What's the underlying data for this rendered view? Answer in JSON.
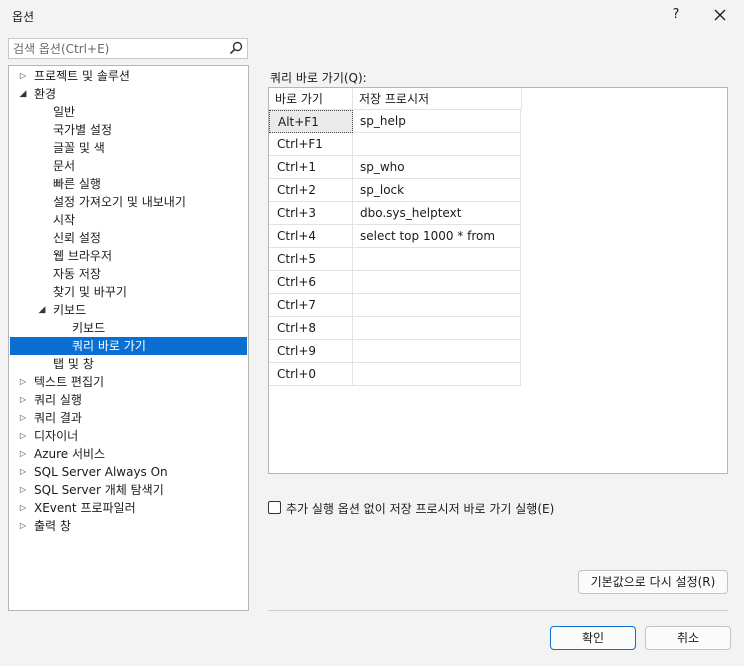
{
  "window": {
    "title": "옵션",
    "help_label": "?",
    "close_label": "✕"
  },
  "search": {
    "placeholder": "검색 옵션(Ctrl+E)",
    "icon": "search-icon"
  },
  "tree": [
    {
      "label": "프로젝트 및 솔루션",
      "level": 0,
      "arrow": "collapsed"
    },
    {
      "label": "환경",
      "level": 0,
      "arrow": "expanded"
    },
    {
      "label": "일반",
      "level": 1,
      "arrow": "none"
    },
    {
      "label": "국가별 설정",
      "level": 1,
      "arrow": "none"
    },
    {
      "label": "글꼴 및 색",
      "level": 1,
      "arrow": "none"
    },
    {
      "label": "문서",
      "level": 1,
      "arrow": "none"
    },
    {
      "label": "빠른 실행",
      "level": 1,
      "arrow": "none"
    },
    {
      "label": "설정 가져오기 및 내보내기",
      "level": 1,
      "arrow": "none"
    },
    {
      "label": "시작",
      "level": 1,
      "arrow": "none"
    },
    {
      "label": "신뢰 설정",
      "level": 1,
      "arrow": "none"
    },
    {
      "label": "웹 브라우저",
      "level": 1,
      "arrow": "none"
    },
    {
      "label": "자동 저장",
      "level": 1,
      "arrow": "none"
    },
    {
      "label": "찾기 및 바꾸기",
      "level": 1,
      "arrow": "none"
    },
    {
      "label": "키보드",
      "level": 1,
      "arrow": "expanded"
    },
    {
      "label": "키보드",
      "level": 2,
      "arrow": "none"
    },
    {
      "label": "쿼리 바로 가기",
      "level": 2,
      "arrow": "none",
      "selected": true
    },
    {
      "label": "탭 및 창",
      "level": 1,
      "arrow": "none"
    },
    {
      "label": "텍스트 편집기",
      "level": 0,
      "arrow": "collapsed"
    },
    {
      "label": "쿼리 실행",
      "level": 0,
      "arrow": "collapsed"
    },
    {
      "label": "쿼리 결과",
      "level": 0,
      "arrow": "collapsed"
    },
    {
      "label": "디자이너",
      "level": 0,
      "arrow": "collapsed"
    },
    {
      "label": "Azure 서비스",
      "level": 0,
      "arrow": "collapsed"
    },
    {
      "label": "SQL Server Always On",
      "level": 0,
      "arrow": "collapsed"
    },
    {
      "label": "SQL Server 개체 탐색기",
      "level": 0,
      "arrow": "collapsed"
    },
    {
      "label": "XEvent 프로파일러",
      "level": 0,
      "arrow": "collapsed"
    },
    {
      "label": "출력 창",
      "level": 0,
      "arrow": "collapsed"
    }
  ],
  "shortcuts": {
    "label": "쿼리 바로 가기(Q):",
    "columns": [
      "바로 가기",
      "저장 프로시저"
    ],
    "rows": [
      {
        "key": "Alt+F1",
        "proc": "sp_help"
      },
      {
        "key": "Ctrl+F1",
        "proc": ""
      },
      {
        "key": "Ctrl+1",
        "proc": "sp_who"
      },
      {
        "key": "Ctrl+2",
        "proc": "sp_lock"
      },
      {
        "key": "Ctrl+3",
        "proc": "dbo.sys_helptext"
      },
      {
        "key": "Ctrl+4",
        "proc": "select top 1000 * from"
      },
      {
        "key": "Ctrl+5",
        "proc": ""
      },
      {
        "key": "Ctrl+6",
        "proc": ""
      },
      {
        "key": "Ctrl+7",
        "proc": ""
      },
      {
        "key": "Ctrl+8",
        "proc": ""
      },
      {
        "key": "Ctrl+9",
        "proc": ""
      },
      {
        "key": "Ctrl+0",
        "proc": ""
      }
    ]
  },
  "checkbox": {
    "label": "추가 실행 옵션 없이 저장 프로시저 바로 가기 실행(E)",
    "checked": false
  },
  "buttons": {
    "reset": "기본값으로 다시 설정(R)",
    "ok": "확인",
    "cancel": "취소"
  }
}
